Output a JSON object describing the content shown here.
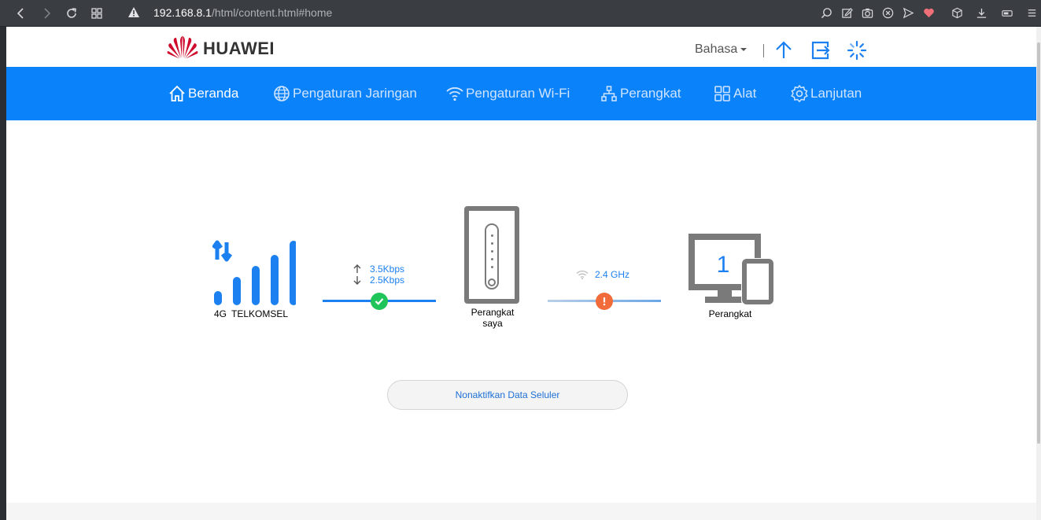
{
  "browser": {
    "url_host": "192.168.8.1",
    "url_path": "/html/content.html#home"
  },
  "header": {
    "brand": "HUAWEI",
    "language_label": "Bahasa"
  },
  "nav": {
    "items": [
      {
        "label": "Beranda",
        "icon": "home-icon",
        "active": true
      },
      {
        "label": "Pengaturan Jaringan",
        "icon": "globe-icon",
        "active": false
      },
      {
        "label": "Pengaturan Wi-Fi",
        "icon": "wifi-icon",
        "active": false
      },
      {
        "label": "Perangkat",
        "icon": "network-icon",
        "active": false
      },
      {
        "label": "Alat",
        "icon": "grid-icon",
        "active": false
      },
      {
        "label": "Lanjutan",
        "icon": "gear-icon",
        "active": false
      }
    ]
  },
  "status": {
    "network_type": "4G",
    "operator": "TELKOMSEL",
    "upload_speed": "3.5Kbps",
    "download_speed": "2.5Kbps",
    "router_label_line1": "Perangkat",
    "router_label_line2": "saya",
    "wifi_band": "2.4 GHz",
    "device_count": "1",
    "devices_label": "Perangkat",
    "connection_status": "ok",
    "wifi_status": "warning"
  },
  "actions": {
    "toggle_mobile_data": "Nonaktifkan Data Seluler"
  },
  "colors": {
    "primary": "#0a82fa",
    "link_blue": "#1d80f0",
    "ok_green": "#1fc45a",
    "warn_orange": "#f26b3a",
    "brand_red": "#cf0a2c"
  }
}
